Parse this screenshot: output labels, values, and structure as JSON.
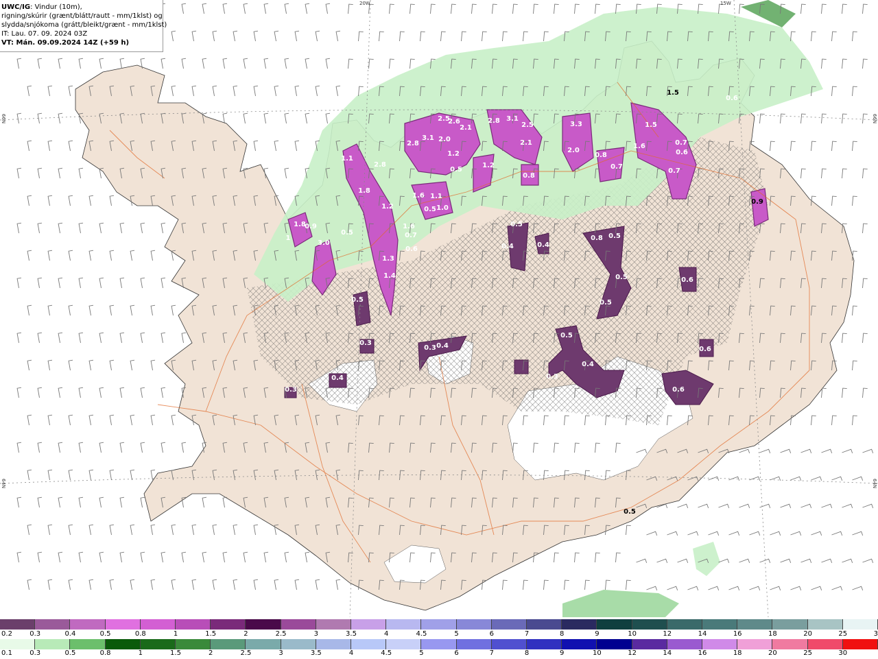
{
  "header": {
    "title_bold": "UWC/IG",
    "title_rest": ": Vindur (10m),",
    "line2": "rigning/skúrir (grænt/blátt/rautt - mm/1klst) og",
    "line3": "slydda/snjókoma (grátt/bleikt/grænt - mm/1klst)",
    "line4": "IT: Lau. 07. 09. 2024 03Z",
    "line5": "VT: Mán. 09.09.2024 14Z (+59 h)"
  },
  "grid_labels": {
    "top_20w": "20W",
    "top_15w": "15W",
    "left_66n": "66N",
    "right_66n": "66N",
    "left_64n": "64N",
    "right_64n": "64N"
  },
  "precip_labels": [
    "1.8",
    "0.9",
    "3.0",
    "1",
    "0.5",
    "1.1",
    "2.8",
    "1.8",
    "1.2",
    "1.6",
    "0.7",
    "0.6",
    "1.4",
    "1.3",
    "0.5",
    "0.3",
    "0.4",
    "3.1",
    "2.8",
    "2.5",
    "2.6",
    "2.0",
    "1.2",
    "0.5",
    "1.6",
    "1.1",
    "0.5",
    "1.0",
    "2.1",
    "1.2",
    "2.8",
    "3.1",
    "2.5",
    "2.1",
    "0.8",
    "0.5",
    "0.4",
    "0.4",
    "3.3",
    "2.0",
    "0.8",
    "0.7",
    "0.8",
    "0.5",
    "0.5",
    "0.5",
    "1.6",
    "1.5",
    "0.7",
    "0.6",
    "0.7",
    "0.6",
    "0.9",
    "1.5",
    "0.3",
    "0.4",
    "0.5",
    "0.4",
    "0.3",
    "0.6",
    "0.6",
    "0.6",
    "0.3",
    "0.5"
  ],
  "colors": {
    "land": "#f1e3d6",
    "sea": "#ffffff",
    "rain_light": "#c8f0c8",
    "rain_mid": "#6cbf6c",
    "snow_purple": "#cc55cc",
    "snow_dark": "#6e3a6e",
    "roads": "#e06a2a"
  },
  "legend": {
    "snow_ticks": [
      "0.2",
      "0.3",
      "0.4",
      "0.5",
      "0.8",
      "1",
      "1.5",
      "2",
      "2.5",
      "3",
      "3.5",
      "4",
      "4.5",
      "5",
      "6",
      "7",
      "8",
      "9",
      "10",
      "12",
      "14",
      "16",
      "18",
      "20",
      "25",
      "30"
    ],
    "rain_ticks": [
      "0.1",
      "0.3",
      "0.5",
      "0.8",
      "1",
      "1.5",
      "2",
      "2.5",
      "3",
      "3.5",
      "4",
      "4.5",
      "5",
      "6",
      "7",
      "8",
      "9",
      "10",
      "12",
      "14",
      "16",
      "18",
      "20",
      "25",
      "30"
    ],
    "snow_colors": [
      "#6b3f6b",
      "#9a5a9a",
      "#c06ac0",
      "#e070e0",
      "#d35fd3",
      "#b84eb8",
      "#7a2a7a",
      "#4a0a4a",
      "#9a4a9a",
      "#b07ab0",
      "#c8a0e8",
      "#b8b8f0",
      "#a0a0e8",
      "#8888d8",
      "#6a6ab8",
      "#4a4a90",
      "#2a2a60",
      "#0f3f3f",
      "#1f4f4f",
      "#3a6a6a",
      "#4a7a7a",
      "#5f8a8a",
      "#7a9e9e",
      "#a8c4c4",
      "#e8f4f4"
    ],
    "rain_colors": [
      "#e8fae8",
      "#b8eab8",
      "#6cbf6c",
      "#0a5a0a",
      "#1a6a1a",
      "#3a8a3a",
      "#5a9a7a",
      "#7aaaaa",
      "#9abaca",
      "#a8b8e8",
      "#b8c8f8",
      "#c8d0f8",
      "#9898f0",
      "#7070e0",
      "#5050d0",
      "#3030c0",
      "#1010b0",
      "#000090",
      "#5a2aa0",
      "#9a5ad0",
      "#d08ae8",
      "#f0a0d8",
      "#f07aa0",
      "#f04a6a",
      "#f01010"
    ]
  }
}
